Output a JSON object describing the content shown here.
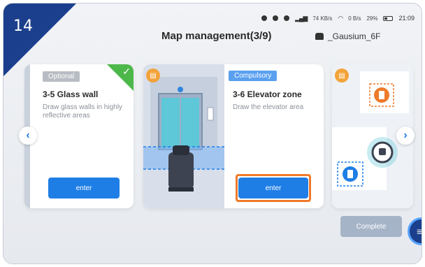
{
  "step_number": "14",
  "header": {
    "title": "Map management(3/9)",
    "map_name": "_Gausium_6F"
  },
  "status_bar": {
    "net_speed_1": "74 KB/s",
    "net_speed_2": "0 B/s",
    "battery": "29%",
    "time": "21:09"
  },
  "cards": [
    {
      "tag": "Optional",
      "title": "3-5  Glass wall",
      "description": "Draw glass walls in highly reflective areas",
      "button": "enter",
      "completed": true
    },
    {
      "tag": "Compulsory",
      "title": "3-6  Elevator zone",
      "description": "Draw the elevator area",
      "button": "enter",
      "highlighted": true
    }
  ],
  "actions": {
    "complete_label": "Complete"
  },
  "colors": {
    "primary": "#1f7ee6",
    "corner": "#1b3f8c",
    "highlight": "#ee7a2b",
    "check": "#4db84a",
    "tag_compulsory": "#5aa0f0",
    "tag_optional": "#b8bcc3"
  },
  "icons": {
    "prev": "chevron-left-icon",
    "next": "chevron-right-icon",
    "book": "book-icon",
    "menu": "menu-icon"
  }
}
